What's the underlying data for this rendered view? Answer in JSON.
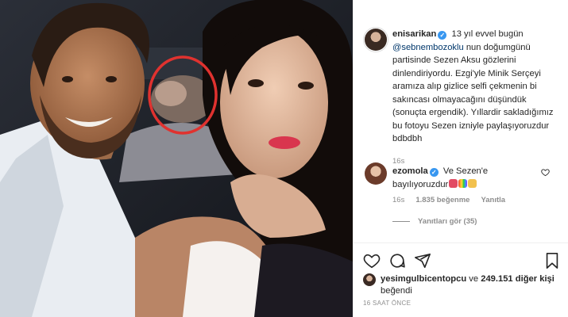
{
  "post": {
    "author": "enisarikan",
    "caption_parts": {
      "intro": " 13 yıl evvel bugün ",
      "mention": "@sebnembozoklu",
      "body": " nun doğumgünü partisinde Sezen Aksu gözlerini dinlendiriyordu. Ezgi'yle Minik Serçeyi aramıza alıp gizlice selfi çekmenin bi sakıncası olmayacağını düşündük (sonuçta ergendik). Yıllardir sakladığımız bu fotoyu Sezen izniyle paylaşıyoruzdur bdbdbh"
    },
    "caption_time": "16s"
  },
  "comment": {
    "author": "ezomola",
    "text": " Ve Sezen'e bayılıyoruzdur",
    "time": "16s",
    "likes": "1.835 beğenme",
    "reply": "Yanıtla",
    "view_replies": "Yanıtları gör (35)"
  },
  "likes_block": {
    "first_liker": "yesimgulbicentopcu",
    "and": " ve ",
    "count": "249.151 diğer kişi",
    "suffix": " beğendi"
  },
  "timestamp": "16 SAAT ÖNCE",
  "colors": {
    "verified": "#3897f0",
    "mention": "#00376b",
    "muted": "#8e8e8e",
    "highlight_circle": "#e0322f"
  },
  "icons": [
    "verified-icon",
    "heart-icon",
    "comment-icon",
    "share-icon",
    "bookmark-icon"
  ]
}
